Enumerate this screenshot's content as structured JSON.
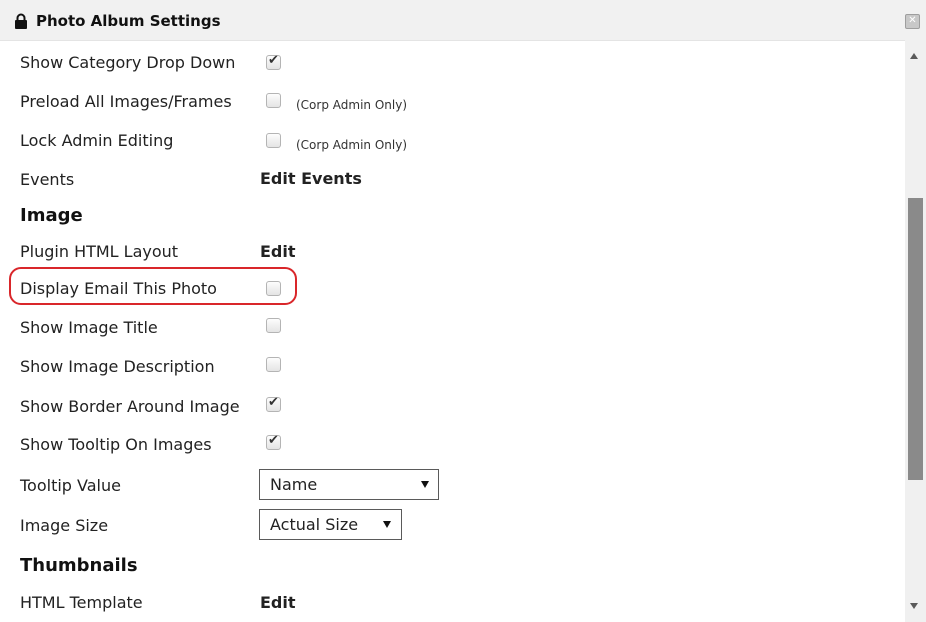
{
  "window": {
    "title": "Photo Album Settings",
    "title_icon": "lock-icon",
    "close_icon": "close-icon"
  },
  "rows": {
    "show_category_drop_down": {
      "label": "Show Category Drop Down",
      "checked": true
    },
    "preload_all_images": {
      "label": "Preload All Images/Frames",
      "checked": false,
      "note": "(Corp Admin Only)"
    },
    "lock_admin_editing": {
      "label": "Lock Admin Editing",
      "checked": false,
      "note": "(Corp Admin Only)"
    },
    "events": {
      "label": "Events",
      "link": "Edit Events"
    },
    "image_section": {
      "title": "Image"
    },
    "plugin_html_layout": {
      "label": "Plugin HTML Layout",
      "link": "Edit"
    },
    "display_email_this_photo": {
      "label": "Display Email This Photo",
      "checked": false
    },
    "show_image_title": {
      "label": "Show Image Title",
      "checked": false
    },
    "show_image_description": {
      "label": "Show Image Description",
      "checked": false
    },
    "show_border_around_image": {
      "label": "Show Border Around Image",
      "checked": true
    },
    "show_tooltip_on_images": {
      "label": "Show Tooltip On Images",
      "checked": true
    },
    "tooltip_value": {
      "label": "Tooltip Value",
      "selected": "Name"
    },
    "image_size": {
      "label": "Image Size",
      "selected": "Actual Size"
    },
    "thumbnails_section": {
      "title": "Thumbnails"
    },
    "html_template": {
      "label": "HTML Template",
      "link": "Edit"
    }
  },
  "colors": {
    "highlight": "#d9262a",
    "titlebar_bg": "#f1f1f1",
    "scroll_thumb": "#8a8a8a"
  }
}
